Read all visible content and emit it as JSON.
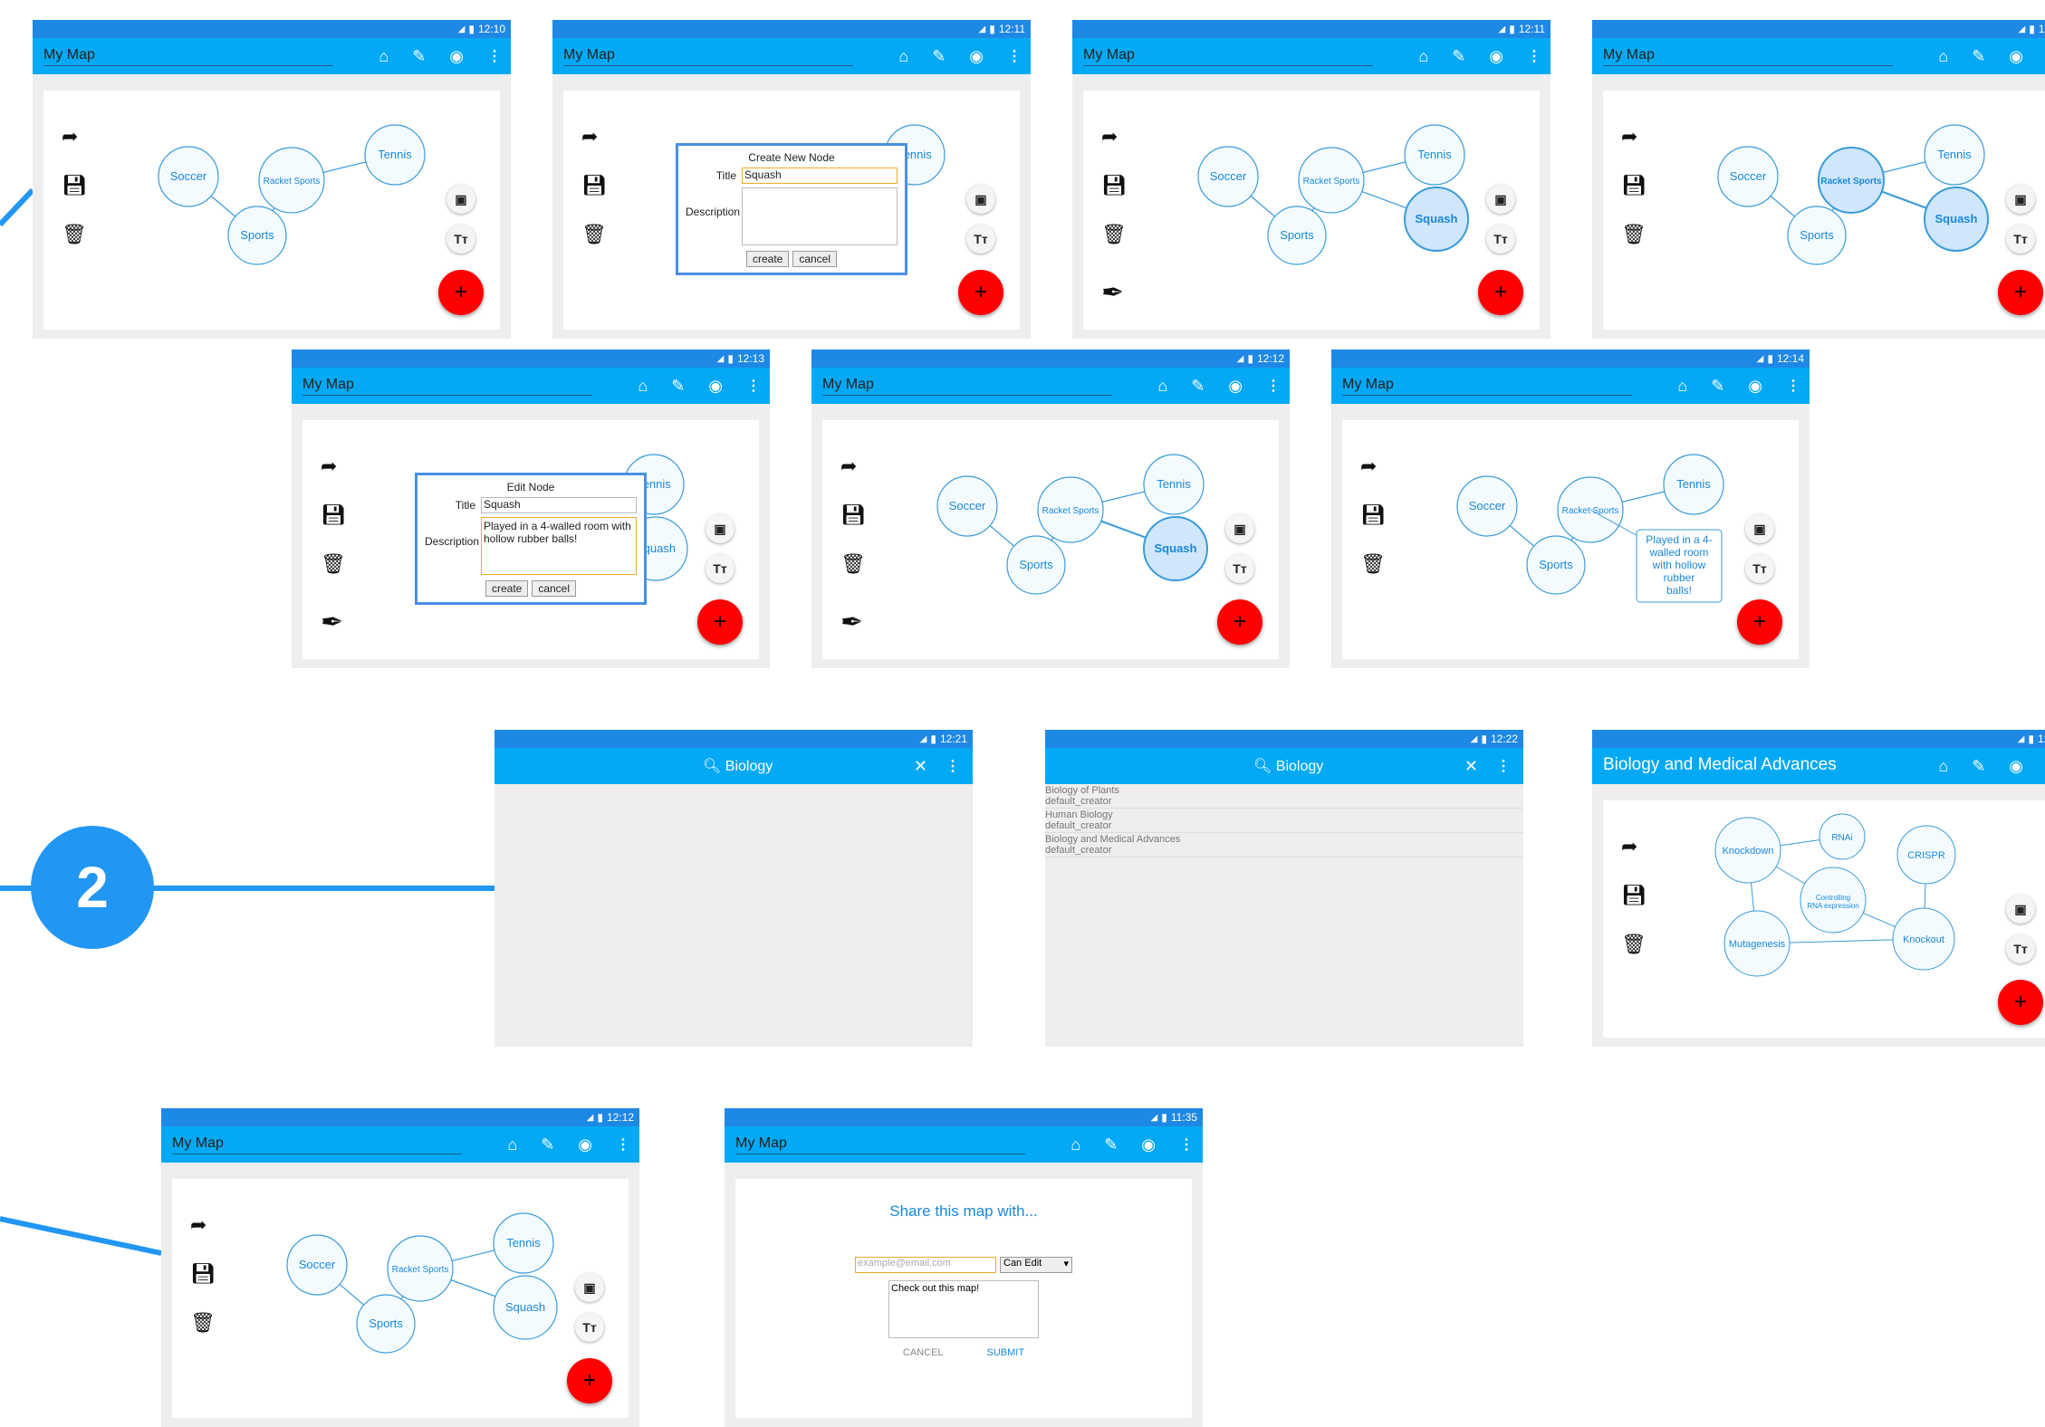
{
  "app": {
    "title": "My Map",
    "search_query": "Biology",
    "bio_title": "Biology and Medical Advances"
  },
  "colors": {
    "accent": "#03a9f4",
    "status": "#1e88e5",
    "fab": "#ff0000",
    "node_stroke": "#3a9bd8",
    "node_fill": "#f4fbff",
    "node_text": "#1a88d8",
    "selected_fill": "#cfe6fb"
  },
  "badge": {
    "number": "2"
  },
  "times": {
    "t1": "12:10",
    "t2": "12:11",
    "t3": "12:11",
    "t4": "12:13",
    "t5": "12:12",
    "t6": "12:14",
    "t7": "12:21",
    "t8": "12:22",
    "t9": "12:12",
    "t10": "11:35"
  },
  "nodes": {
    "soccer": "Soccer",
    "racket": "Racket Sports",
    "tennis": "Tennis",
    "sports": "Sports",
    "squash": "Squash",
    "note": [
      "Played in a 4-",
      "walled room",
      "with hollow",
      "rubber",
      "balls!"
    ]
  },
  "create_dialog": {
    "heading": "Create New Node",
    "title_label": "Title",
    "title_value": "Squash",
    "desc_label": "Description",
    "desc_value": "",
    "create": "create",
    "cancel": "cancel"
  },
  "edit_dialog": {
    "heading": "Edit Node",
    "title_label": "Title",
    "title_value": "Squash",
    "desc_label": "Description",
    "desc_value": "Played in a 4-walled room with hollow rubber balls!",
    "create": "create",
    "cancel": "cancel"
  },
  "search_results": [
    {
      "title": "Biology of Plants",
      "creator": "default_creator"
    },
    {
      "title": "Human Biology",
      "creator": "default_creator"
    },
    {
      "title": "Biology and Medical Advances",
      "creator": "default_creator"
    }
  ],
  "bio_nodes": {
    "knockdown": "Knockdown",
    "rnai": "RNAi",
    "crispr": "CRISPR",
    "controlling": [
      "Controlling",
      "RNA expression"
    ],
    "mutagenesis": "Mutagenesis",
    "knockout": "Knockout"
  },
  "share": {
    "heading": "Share this map with...",
    "email_placeholder": "example@email.com",
    "permission": "Can Edit",
    "message": "Check out this map!",
    "cancel": "CANCEL",
    "submit": "SUBMIT"
  },
  "icons": [
    "home-icon",
    "pencil-icon",
    "compass-icon",
    "more-icon",
    "share-arrow-icon",
    "save-icon",
    "trash-icon",
    "pen-nib-icon",
    "image-icon",
    "text-size-icon",
    "add-icon",
    "search-icon",
    "close-icon"
  ]
}
